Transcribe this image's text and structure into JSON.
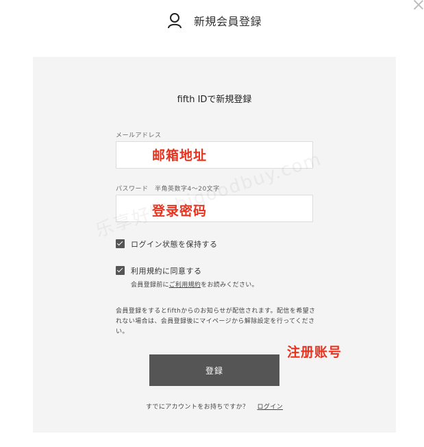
{
  "header": {
    "title": "新規会員登録",
    "icon": "user-icon"
  },
  "close": {
    "icon": "close-icon"
  },
  "form": {
    "title": "fifth IDで新規登録",
    "email": {
      "label": "メールアドレス",
      "value": ""
    },
    "password": {
      "label": "パスワード　半角英数字4〜20文字",
      "value": ""
    },
    "keep_login": {
      "label": "ログイン状態を保持する",
      "checked": true
    },
    "terms": {
      "label": "利用規約に同意する",
      "checked": true,
      "note_prefix": "会員登録前に",
      "note_link": "ご利用規約",
      "note_suffix": "をお読みください。"
    },
    "notice": "会員登録をするとfifthからのお知らせが配信されます。配信を希望されない場合は、会員登録後にマイページから解除設定を行ってください。",
    "submit_label": "登録",
    "footer_text": "すでにアカウントをお持ちですか？",
    "footer_link": "ログイン"
  },
  "overlays": {
    "email_hint": "邮箱地址",
    "password_hint": "登录密码",
    "signup_hint": "注册账号",
    "watermark": "乐享好物 bigoodbuy.com"
  },
  "colors": {
    "accent_red": "#e8321e",
    "button": "#555555",
    "panel": "#f4f4f4"
  }
}
